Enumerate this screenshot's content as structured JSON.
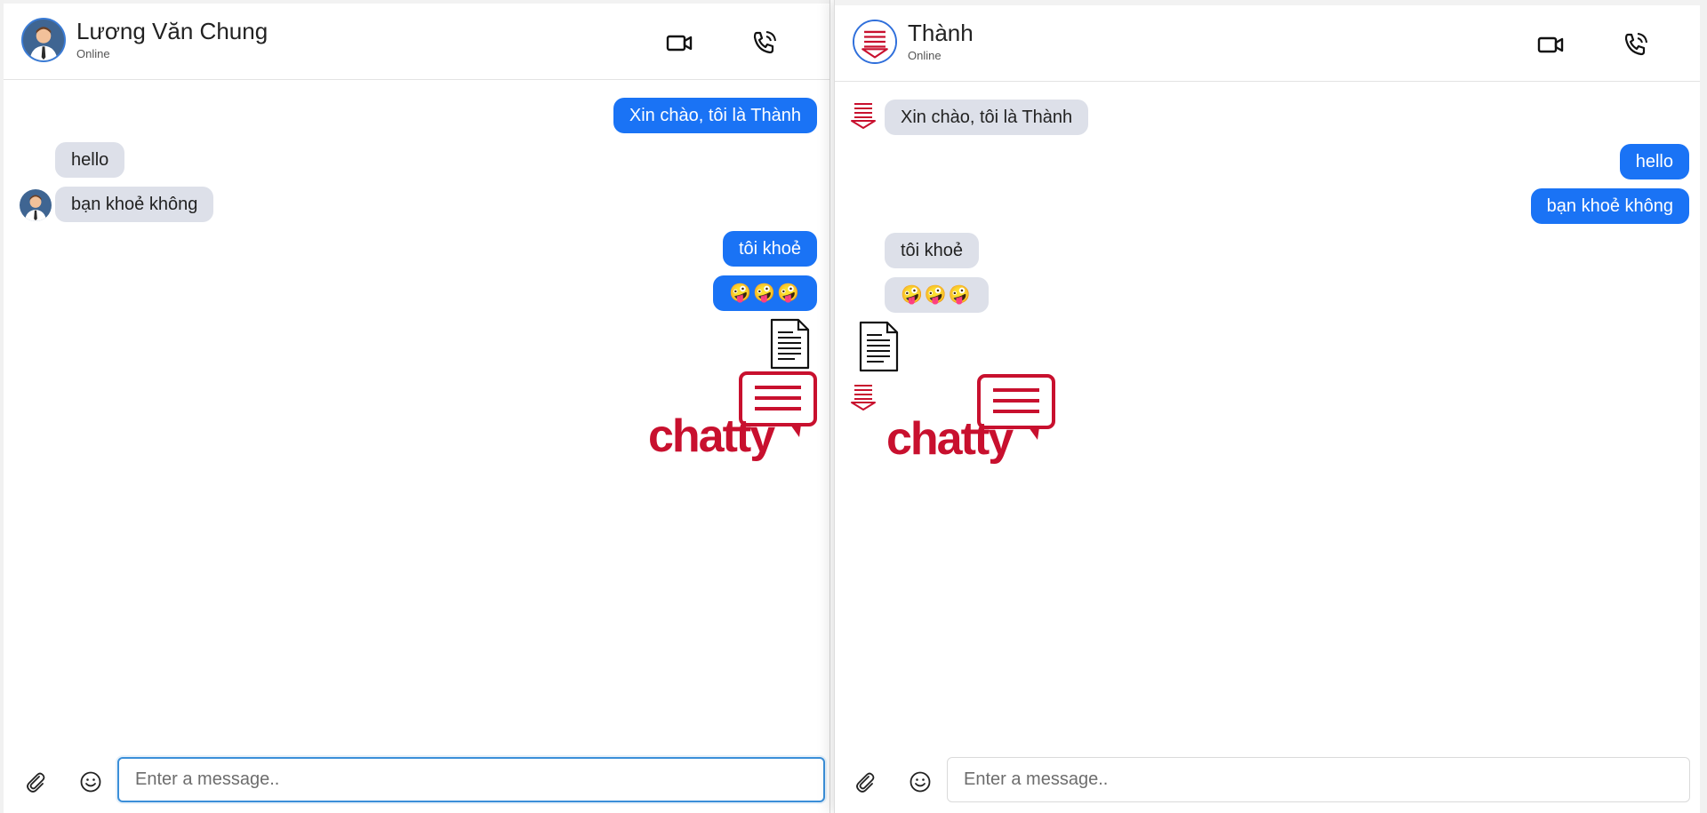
{
  "left_chat": {
    "contact": {
      "name": "Lương Văn Chung",
      "status": "Online"
    },
    "icons": {
      "video": "video-camera-icon",
      "call": "phone-call-icon",
      "attach": "paperclip-icon",
      "emoji": "smiley-icon"
    },
    "messages": [
      {
        "direction": "out",
        "text": "Xin chào, tôi là Thành"
      },
      {
        "direction": "in",
        "text": "hello"
      },
      {
        "direction": "in",
        "text": "bạn khoẻ không"
      },
      {
        "direction": "out",
        "text": "tôi khoẻ"
      },
      {
        "direction": "out",
        "text": "🤪🤪🤪"
      },
      {
        "direction": "out",
        "type": "file",
        "icon": "document-icon"
      },
      {
        "direction": "out",
        "type": "image",
        "logo_text": "chatty"
      }
    ],
    "input": {
      "placeholder": "Enter a message.."
    }
  },
  "right_chat": {
    "contact": {
      "name": "Thành",
      "status": "Online"
    },
    "icons": {
      "video": "video-camera-icon",
      "call": "phone-call-icon",
      "attach": "paperclip-icon",
      "emoji": "smiley-icon"
    },
    "messages": [
      {
        "direction": "in",
        "text": "Xin chào, tôi là Thành"
      },
      {
        "direction": "out",
        "text": "hello"
      },
      {
        "direction": "out",
        "text": "bạn khoẻ không"
      },
      {
        "direction": "in",
        "text": "tôi khoẻ"
      },
      {
        "direction": "in",
        "text": "🤪🤪🤪"
      },
      {
        "direction": "in",
        "type": "file",
        "icon": "document-icon"
      },
      {
        "direction": "in",
        "type": "image",
        "logo_text": "chatty"
      }
    ],
    "input": {
      "placeholder": "Enter a message.."
    }
  },
  "colors": {
    "outgoing_bubble": "#1a73f5",
    "incoming_bubble": "#dde0e9",
    "brand_red": "#c8102e",
    "input_focus": "#3b8fd9"
  }
}
